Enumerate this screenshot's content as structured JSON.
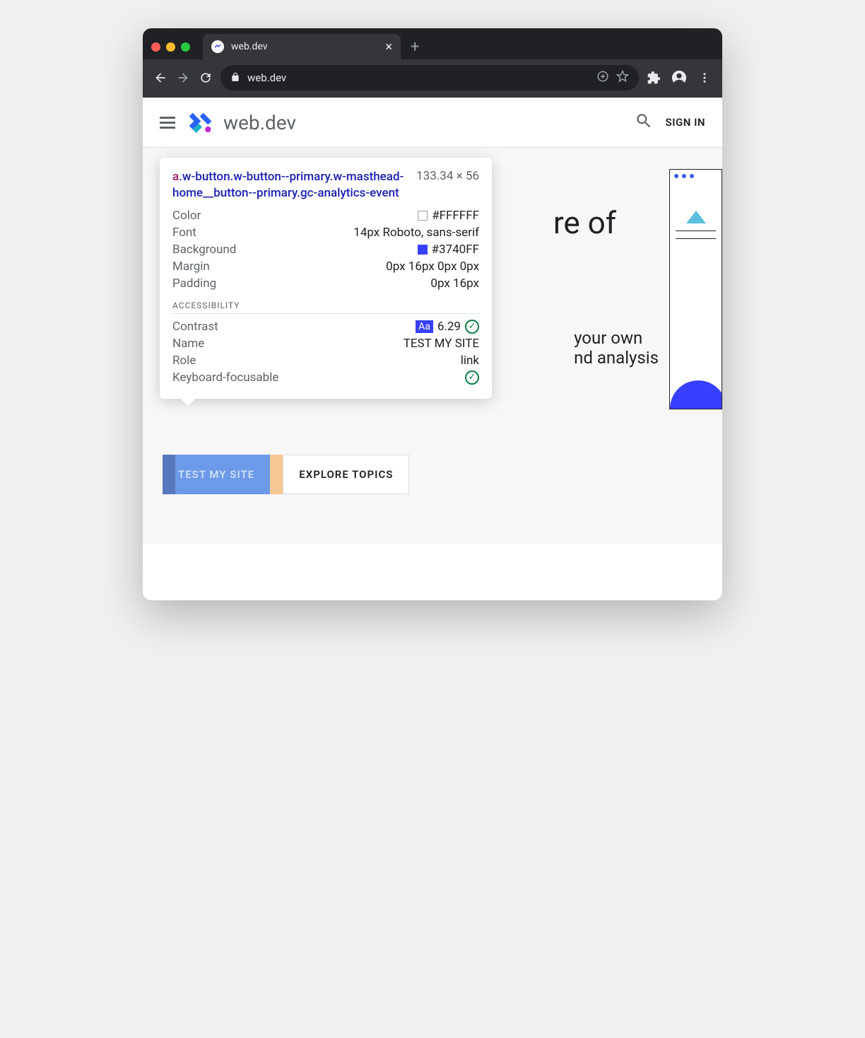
{
  "browser": {
    "tab_title": "web.dev",
    "address": "web.dev"
  },
  "header": {
    "brand": "web.dev",
    "signin": "SIGN IN"
  },
  "hero": {
    "title_fragment": "re of",
    "sub_line1": "your own",
    "sub_line2": "nd analysis"
  },
  "buttons": {
    "primary": "TEST MY SITE",
    "secondary": "EXPLORE TOPICS"
  },
  "tooltip": {
    "tag": "a",
    "selector": ".w-button.w-button--primary.w-masthead-home__button--primary.gc-analytics-event",
    "dimensions": "133.34 × 56",
    "styles": {
      "color_label": "Color",
      "color_value": "#FFFFFF",
      "font_label": "Font",
      "font_value": "14px Roboto, sans-serif",
      "background_label": "Background",
      "background_value": "#3740FF",
      "margin_label": "Margin",
      "margin_value": "0px 16px 0px 0px",
      "padding_label": "Padding",
      "padding_value": "0px 16px"
    },
    "accessibility": {
      "section_label": "ACCESSIBILITY",
      "contrast_label": "Contrast",
      "contrast_badge": "Aa",
      "contrast_value": "6.29",
      "name_label": "Name",
      "name_value": "TEST MY SITE",
      "role_label": "Role",
      "role_value": "link",
      "focusable_label": "Keyboard-focusable"
    }
  }
}
